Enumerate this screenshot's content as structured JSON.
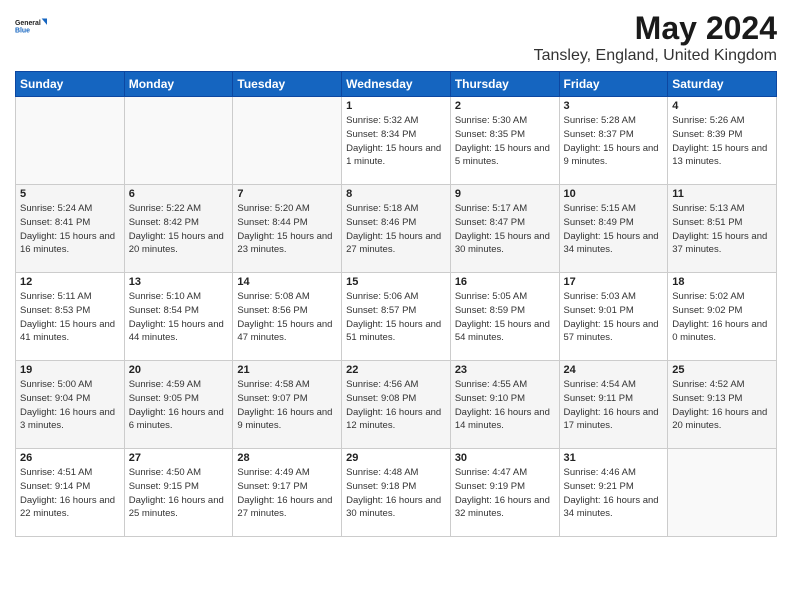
{
  "logo": {
    "line1": "General",
    "line2": "Blue"
  },
  "title": "May 2024",
  "location": "Tansley, England, United Kingdom",
  "days_of_week": [
    "Sunday",
    "Monday",
    "Tuesday",
    "Wednesday",
    "Thursday",
    "Friday",
    "Saturday"
  ],
  "weeks": [
    [
      {
        "num": "",
        "sunrise": "",
        "sunset": "",
        "daylight": ""
      },
      {
        "num": "",
        "sunrise": "",
        "sunset": "",
        "daylight": ""
      },
      {
        "num": "",
        "sunrise": "",
        "sunset": "",
        "daylight": ""
      },
      {
        "num": "1",
        "sunrise": "Sunrise: 5:32 AM",
        "sunset": "Sunset: 8:34 PM",
        "daylight": "Daylight: 15 hours and 1 minute."
      },
      {
        "num": "2",
        "sunrise": "Sunrise: 5:30 AM",
        "sunset": "Sunset: 8:35 PM",
        "daylight": "Daylight: 15 hours and 5 minutes."
      },
      {
        "num": "3",
        "sunrise": "Sunrise: 5:28 AM",
        "sunset": "Sunset: 8:37 PM",
        "daylight": "Daylight: 15 hours and 9 minutes."
      },
      {
        "num": "4",
        "sunrise": "Sunrise: 5:26 AM",
        "sunset": "Sunset: 8:39 PM",
        "daylight": "Daylight: 15 hours and 13 minutes."
      }
    ],
    [
      {
        "num": "5",
        "sunrise": "Sunrise: 5:24 AM",
        "sunset": "Sunset: 8:41 PM",
        "daylight": "Daylight: 15 hours and 16 minutes."
      },
      {
        "num": "6",
        "sunrise": "Sunrise: 5:22 AM",
        "sunset": "Sunset: 8:42 PM",
        "daylight": "Daylight: 15 hours and 20 minutes."
      },
      {
        "num": "7",
        "sunrise": "Sunrise: 5:20 AM",
        "sunset": "Sunset: 8:44 PM",
        "daylight": "Daylight: 15 hours and 23 minutes."
      },
      {
        "num": "8",
        "sunrise": "Sunrise: 5:18 AM",
        "sunset": "Sunset: 8:46 PM",
        "daylight": "Daylight: 15 hours and 27 minutes."
      },
      {
        "num": "9",
        "sunrise": "Sunrise: 5:17 AM",
        "sunset": "Sunset: 8:47 PM",
        "daylight": "Daylight: 15 hours and 30 minutes."
      },
      {
        "num": "10",
        "sunrise": "Sunrise: 5:15 AM",
        "sunset": "Sunset: 8:49 PM",
        "daylight": "Daylight: 15 hours and 34 minutes."
      },
      {
        "num": "11",
        "sunrise": "Sunrise: 5:13 AM",
        "sunset": "Sunset: 8:51 PM",
        "daylight": "Daylight: 15 hours and 37 minutes."
      }
    ],
    [
      {
        "num": "12",
        "sunrise": "Sunrise: 5:11 AM",
        "sunset": "Sunset: 8:53 PM",
        "daylight": "Daylight: 15 hours and 41 minutes."
      },
      {
        "num": "13",
        "sunrise": "Sunrise: 5:10 AM",
        "sunset": "Sunset: 8:54 PM",
        "daylight": "Daylight: 15 hours and 44 minutes."
      },
      {
        "num": "14",
        "sunrise": "Sunrise: 5:08 AM",
        "sunset": "Sunset: 8:56 PM",
        "daylight": "Daylight: 15 hours and 47 minutes."
      },
      {
        "num": "15",
        "sunrise": "Sunrise: 5:06 AM",
        "sunset": "Sunset: 8:57 PM",
        "daylight": "Daylight: 15 hours and 51 minutes."
      },
      {
        "num": "16",
        "sunrise": "Sunrise: 5:05 AM",
        "sunset": "Sunset: 8:59 PM",
        "daylight": "Daylight: 15 hours and 54 minutes."
      },
      {
        "num": "17",
        "sunrise": "Sunrise: 5:03 AM",
        "sunset": "Sunset: 9:01 PM",
        "daylight": "Daylight: 15 hours and 57 minutes."
      },
      {
        "num": "18",
        "sunrise": "Sunrise: 5:02 AM",
        "sunset": "Sunset: 9:02 PM",
        "daylight": "Daylight: 16 hours and 0 minutes."
      }
    ],
    [
      {
        "num": "19",
        "sunrise": "Sunrise: 5:00 AM",
        "sunset": "Sunset: 9:04 PM",
        "daylight": "Daylight: 16 hours and 3 minutes."
      },
      {
        "num": "20",
        "sunrise": "Sunrise: 4:59 AM",
        "sunset": "Sunset: 9:05 PM",
        "daylight": "Daylight: 16 hours and 6 minutes."
      },
      {
        "num": "21",
        "sunrise": "Sunrise: 4:58 AM",
        "sunset": "Sunset: 9:07 PM",
        "daylight": "Daylight: 16 hours and 9 minutes."
      },
      {
        "num": "22",
        "sunrise": "Sunrise: 4:56 AM",
        "sunset": "Sunset: 9:08 PM",
        "daylight": "Daylight: 16 hours and 12 minutes."
      },
      {
        "num": "23",
        "sunrise": "Sunrise: 4:55 AM",
        "sunset": "Sunset: 9:10 PM",
        "daylight": "Daylight: 16 hours and 14 minutes."
      },
      {
        "num": "24",
        "sunrise": "Sunrise: 4:54 AM",
        "sunset": "Sunset: 9:11 PM",
        "daylight": "Daylight: 16 hours and 17 minutes."
      },
      {
        "num": "25",
        "sunrise": "Sunrise: 4:52 AM",
        "sunset": "Sunset: 9:13 PM",
        "daylight": "Daylight: 16 hours and 20 minutes."
      }
    ],
    [
      {
        "num": "26",
        "sunrise": "Sunrise: 4:51 AM",
        "sunset": "Sunset: 9:14 PM",
        "daylight": "Daylight: 16 hours and 22 minutes."
      },
      {
        "num": "27",
        "sunrise": "Sunrise: 4:50 AM",
        "sunset": "Sunset: 9:15 PM",
        "daylight": "Daylight: 16 hours and 25 minutes."
      },
      {
        "num": "28",
        "sunrise": "Sunrise: 4:49 AM",
        "sunset": "Sunset: 9:17 PM",
        "daylight": "Daylight: 16 hours and 27 minutes."
      },
      {
        "num": "29",
        "sunrise": "Sunrise: 4:48 AM",
        "sunset": "Sunset: 9:18 PM",
        "daylight": "Daylight: 16 hours and 30 minutes."
      },
      {
        "num": "30",
        "sunrise": "Sunrise: 4:47 AM",
        "sunset": "Sunset: 9:19 PM",
        "daylight": "Daylight: 16 hours and 32 minutes."
      },
      {
        "num": "31",
        "sunrise": "Sunrise: 4:46 AM",
        "sunset": "Sunset: 9:21 PM",
        "daylight": "Daylight: 16 hours and 34 minutes."
      },
      {
        "num": "",
        "sunrise": "",
        "sunset": "",
        "daylight": ""
      }
    ]
  ]
}
